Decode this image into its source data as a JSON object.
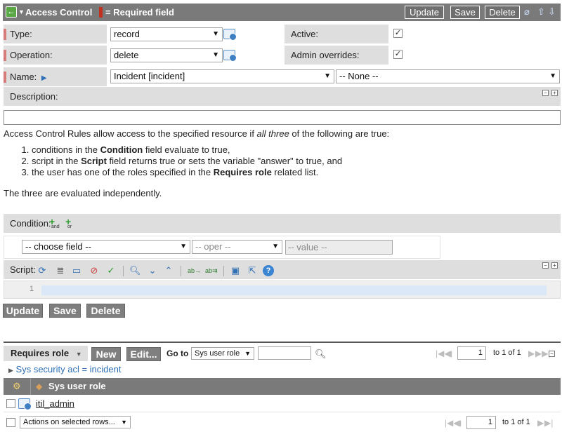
{
  "header": {
    "title": "Access Control",
    "required_legend": "= Required field",
    "update_label": "Update",
    "save_label": "Save",
    "delete_label": "Delete"
  },
  "form": {
    "type": {
      "label": "Type:",
      "value": "record"
    },
    "operation": {
      "label": "Operation:",
      "value": "delete"
    },
    "active": {
      "label": "Active:",
      "checked": true
    },
    "admin_overrides": {
      "label": "Admin overrides:",
      "checked": true
    },
    "name": {
      "label": "Name:",
      "table_value": "Incident [incident]",
      "field_value": "-- None --"
    },
    "description": {
      "label": "Description:",
      "value": ""
    }
  },
  "info": {
    "intro_before": "Access Control Rules allow access to the specified resource if ",
    "intro_em": "all three",
    "intro_after": " of the following are true:",
    "items": [
      {
        "before": "conditions in the ",
        "strong": "Condition",
        "after": " field evaluate to true,"
      },
      {
        "before": "script in the ",
        "strong": "Script",
        "after": " field returns true or sets the variable \"answer\" to true, and"
      },
      {
        "before": "the user has one of the roles specified in the ",
        "strong": "Requires role",
        "after": " related list."
      }
    ],
    "footer": "The three are evaluated independently."
  },
  "condition": {
    "label": "Condition:",
    "and_label": "and",
    "or_label": "or",
    "field_placeholder": "-- choose field --",
    "oper_placeholder": "-- oper --",
    "value_placeholder": "-- value --"
  },
  "script": {
    "label": "Script:",
    "line_number": "1",
    "content": ""
  },
  "bottom_buttons": {
    "update": "Update",
    "save": "Save",
    "delete": "Delete"
  },
  "related_list": {
    "title": "Requires role",
    "new_label": "New",
    "edit_label": "Edit...",
    "goto_label": "Go to",
    "goto_field": "Sys user role",
    "search_value": "",
    "page_input": "1",
    "page_info": "to 1 of 1",
    "filter_text": "Sys security acl = incident",
    "column_header": "Sys user role",
    "rows": [
      {
        "value": "itil_admin"
      }
    ],
    "actions_label": "Actions on selected rows...",
    "bottom_page_input": "1",
    "bottom_page_info": "to 1 of 1"
  }
}
